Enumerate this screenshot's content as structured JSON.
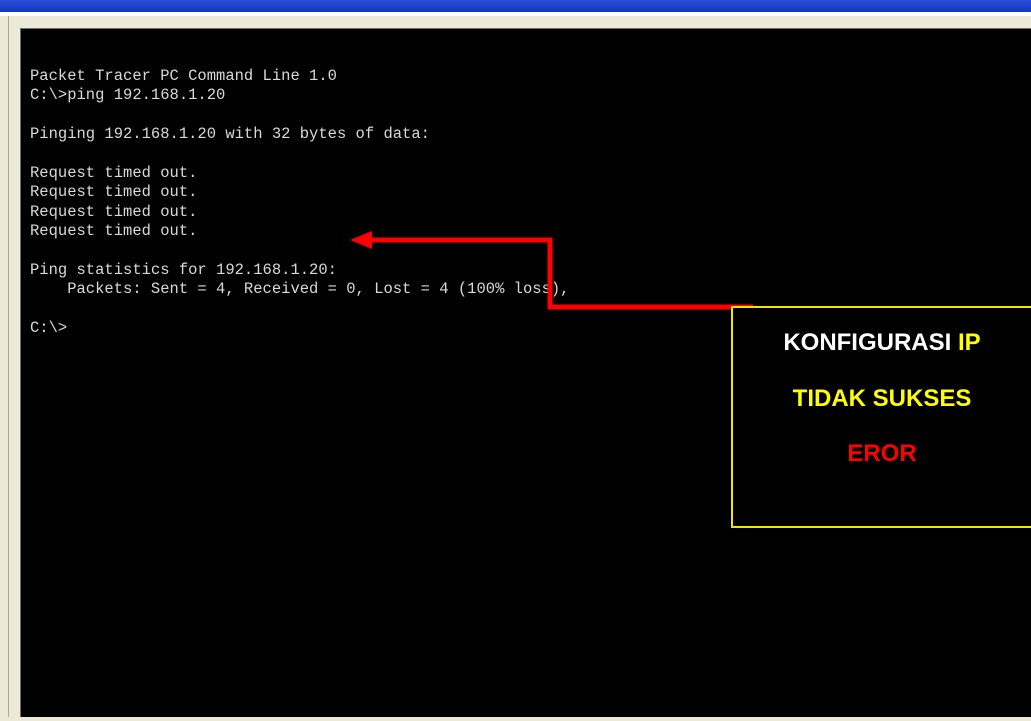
{
  "console": {
    "lines": [
      "Packet Tracer PC Command Line 1.0",
      "C:\\>ping 192.168.1.20",
      "",
      "Pinging 192.168.1.20 with 32 bytes of data:",
      "",
      "Request timed out.",
      "Request timed out.",
      "Request timed out.",
      "Request timed out.",
      "",
      "Ping statistics for 192.168.1.20:",
      "    Packets: Sent = 4, Received = 0, Lost = 4 (100% loss),",
      "",
      "C:\\>"
    ]
  },
  "callout": {
    "line1_part1": "KONFIGURASI ",
    "line1_part2": "IP",
    "line2": "TIDAK SUKSES",
    "line3": "EROR"
  },
  "colors": {
    "console_background": "#000000",
    "console_text": "#d9d9d9",
    "arrow": "#ff0000",
    "callout_border": "#f2e600",
    "callout_white_text": "#ffffff",
    "callout_yellow_text": "#ffff00",
    "callout_red_text": "#ff0000",
    "title_bar": "#1035c4"
  }
}
